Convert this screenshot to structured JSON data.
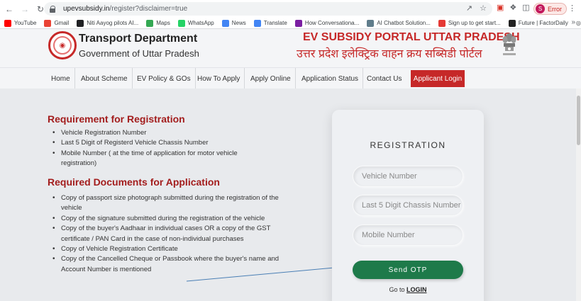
{
  "browser": {
    "url_host": "upevsubsidy.in",
    "url_path": "/register?disclaimer=true",
    "profile_label": "Error",
    "profile_initial": "S"
  },
  "bookmarks": [
    {
      "label": "YouTube",
      "color": "#ff0000",
      "icon": "youtube-icon"
    },
    {
      "label": "Gmail",
      "color": "#ea4335",
      "icon": "gmail-icon"
    },
    {
      "label": "Niti Aayog pilots AI...",
      "color": "#202124",
      "icon": "niti-icon"
    },
    {
      "label": "Maps",
      "color": "#34a853",
      "icon": "maps-icon"
    },
    {
      "label": "WhatsApp",
      "color": "#25d366",
      "icon": "whatsapp-icon"
    },
    {
      "label": "News",
      "color": "#4285f4",
      "icon": "news-icon"
    },
    {
      "label": "Translate",
      "color": "#4285f4",
      "icon": "translate-icon"
    },
    {
      "label": "How Conversationa...",
      "color": "#7b1fa2",
      "icon": "conversational-icon"
    },
    {
      "label": "AI Chatbot Solution...",
      "color": "#607d8b",
      "icon": "chatbot-icon"
    },
    {
      "label": "Sign up to get start...",
      "color": "#e53935",
      "icon": "signup-icon"
    },
    {
      "label": "Future | FactorDaily",
      "color": "#212121",
      "icon": "factordaily-icon"
    }
  ],
  "header": {
    "dept_title": "Transport Department",
    "dept_sub": "Government of Uttar Pradesh",
    "portal_en": "EV SUBSIDY PORTAL UTTAR PRADESH",
    "portal_hi": "उत्तर प्रदेश इलेक्ट्रिक वाहन क्रय सब्सिडी पोर्टल"
  },
  "nav": {
    "items": [
      "Home",
      "About Scheme",
      "EV Policy & GOs",
      "How To Apply",
      "Apply Online",
      "Application Status",
      "Contact Us"
    ],
    "login": "Applicant Login"
  },
  "requirements": {
    "title": "Requirement for Registration",
    "items": [
      "Vehicle Registration Number",
      "Last 5 Digit of Registerd Vehicle Chassis Number",
      "Mobile Number ( at the time of application for motor vehicle registration)"
    ]
  },
  "documents": {
    "title": "Required Documents for Application",
    "items": [
      "Copy of passport size photograph submitted during the registration of the vehicle",
      "Copy of the signature submitted during the registration of the vehicle",
      "Copy of the buyer's Aadhaar in individual cases OR a copy of the GST certificate / PAN Card in the case of non-individual purchases",
      "Copy of Vehicle Registration Certificate",
      "Copy of the Cancelled Cheque or Passbook where the buyer's name and Account Number is mentioned"
    ]
  },
  "registration": {
    "title": "REGISTRATION",
    "vehicle_placeholder": "Vehicle Number",
    "chassis_placeholder": "Last 5 Digit Chassis Number",
    "mobile_placeholder": "Mobile Number",
    "otp_button": "Send OTP",
    "goto_text": "Go to ",
    "login_link": "LOGIN"
  },
  "colors": {
    "brand_red": "#c62828",
    "otp_green": "#1e7a4a",
    "heading_red": "#a31d1d"
  }
}
